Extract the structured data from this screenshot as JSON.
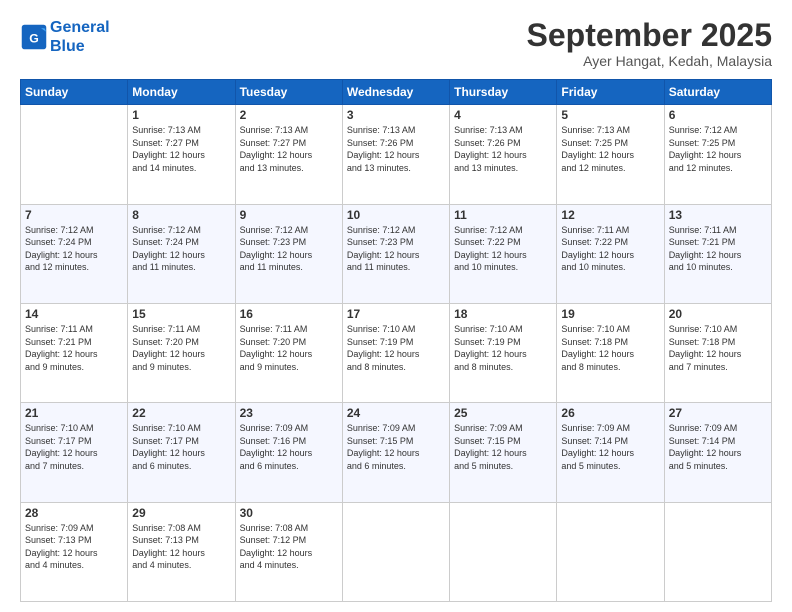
{
  "header": {
    "logo_line1": "General",
    "logo_line2": "Blue",
    "month_title": "September 2025",
    "location": "Ayer Hangat, Kedah, Malaysia"
  },
  "days_of_week": [
    "Sunday",
    "Monday",
    "Tuesday",
    "Wednesday",
    "Thursday",
    "Friday",
    "Saturday"
  ],
  "weeks": [
    [
      {
        "day": "",
        "info": ""
      },
      {
        "day": "1",
        "info": "Sunrise: 7:13 AM\nSunset: 7:27 PM\nDaylight: 12 hours\nand 14 minutes."
      },
      {
        "day": "2",
        "info": "Sunrise: 7:13 AM\nSunset: 7:27 PM\nDaylight: 12 hours\nand 13 minutes."
      },
      {
        "day": "3",
        "info": "Sunrise: 7:13 AM\nSunset: 7:26 PM\nDaylight: 12 hours\nand 13 minutes."
      },
      {
        "day": "4",
        "info": "Sunrise: 7:13 AM\nSunset: 7:26 PM\nDaylight: 12 hours\nand 13 minutes."
      },
      {
        "day": "5",
        "info": "Sunrise: 7:13 AM\nSunset: 7:25 PM\nDaylight: 12 hours\nand 12 minutes."
      },
      {
        "day": "6",
        "info": "Sunrise: 7:12 AM\nSunset: 7:25 PM\nDaylight: 12 hours\nand 12 minutes."
      }
    ],
    [
      {
        "day": "7",
        "info": "Sunrise: 7:12 AM\nSunset: 7:24 PM\nDaylight: 12 hours\nand 12 minutes."
      },
      {
        "day": "8",
        "info": "Sunrise: 7:12 AM\nSunset: 7:24 PM\nDaylight: 12 hours\nand 11 minutes."
      },
      {
        "day": "9",
        "info": "Sunrise: 7:12 AM\nSunset: 7:23 PM\nDaylight: 12 hours\nand 11 minutes."
      },
      {
        "day": "10",
        "info": "Sunrise: 7:12 AM\nSunset: 7:23 PM\nDaylight: 12 hours\nand 11 minutes."
      },
      {
        "day": "11",
        "info": "Sunrise: 7:12 AM\nSunset: 7:22 PM\nDaylight: 12 hours\nand 10 minutes."
      },
      {
        "day": "12",
        "info": "Sunrise: 7:11 AM\nSunset: 7:22 PM\nDaylight: 12 hours\nand 10 minutes."
      },
      {
        "day": "13",
        "info": "Sunrise: 7:11 AM\nSunset: 7:21 PM\nDaylight: 12 hours\nand 10 minutes."
      }
    ],
    [
      {
        "day": "14",
        "info": "Sunrise: 7:11 AM\nSunset: 7:21 PM\nDaylight: 12 hours\nand 9 minutes."
      },
      {
        "day": "15",
        "info": "Sunrise: 7:11 AM\nSunset: 7:20 PM\nDaylight: 12 hours\nand 9 minutes."
      },
      {
        "day": "16",
        "info": "Sunrise: 7:11 AM\nSunset: 7:20 PM\nDaylight: 12 hours\nand 9 minutes."
      },
      {
        "day": "17",
        "info": "Sunrise: 7:10 AM\nSunset: 7:19 PM\nDaylight: 12 hours\nand 8 minutes."
      },
      {
        "day": "18",
        "info": "Sunrise: 7:10 AM\nSunset: 7:19 PM\nDaylight: 12 hours\nand 8 minutes."
      },
      {
        "day": "19",
        "info": "Sunrise: 7:10 AM\nSunset: 7:18 PM\nDaylight: 12 hours\nand 8 minutes."
      },
      {
        "day": "20",
        "info": "Sunrise: 7:10 AM\nSunset: 7:18 PM\nDaylight: 12 hours\nand 7 minutes."
      }
    ],
    [
      {
        "day": "21",
        "info": "Sunrise: 7:10 AM\nSunset: 7:17 PM\nDaylight: 12 hours\nand 7 minutes."
      },
      {
        "day": "22",
        "info": "Sunrise: 7:10 AM\nSunset: 7:17 PM\nDaylight: 12 hours\nand 6 minutes."
      },
      {
        "day": "23",
        "info": "Sunrise: 7:09 AM\nSunset: 7:16 PM\nDaylight: 12 hours\nand 6 minutes."
      },
      {
        "day": "24",
        "info": "Sunrise: 7:09 AM\nSunset: 7:15 PM\nDaylight: 12 hours\nand 6 minutes."
      },
      {
        "day": "25",
        "info": "Sunrise: 7:09 AM\nSunset: 7:15 PM\nDaylight: 12 hours\nand 5 minutes."
      },
      {
        "day": "26",
        "info": "Sunrise: 7:09 AM\nSunset: 7:14 PM\nDaylight: 12 hours\nand 5 minutes."
      },
      {
        "day": "27",
        "info": "Sunrise: 7:09 AM\nSunset: 7:14 PM\nDaylight: 12 hours\nand 5 minutes."
      }
    ],
    [
      {
        "day": "28",
        "info": "Sunrise: 7:09 AM\nSunset: 7:13 PM\nDaylight: 12 hours\nand 4 minutes."
      },
      {
        "day": "29",
        "info": "Sunrise: 7:08 AM\nSunset: 7:13 PM\nDaylight: 12 hours\nand 4 minutes."
      },
      {
        "day": "30",
        "info": "Sunrise: 7:08 AM\nSunset: 7:12 PM\nDaylight: 12 hours\nand 4 minutes."
      },
      {
        "day": "",
        "info": ""
      },
      {
        "day": "",
        "info": ""
      },
      {
        "day": "",
        "info": ""
      },
      {
        "day": "",
        "info": ""
      }
    ]
  ]
}
